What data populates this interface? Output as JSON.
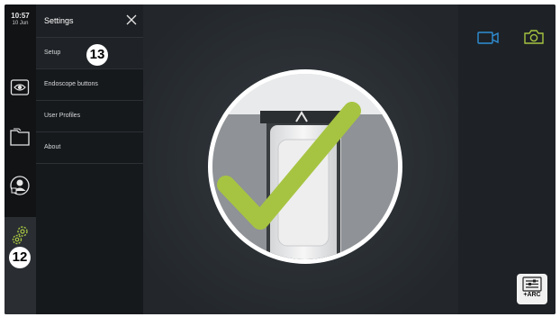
{
  "status": {
    "time": "10:57",
    "date": "10 Jun"
  },
  "rail": {
    "items": [
      {
        "name": "eye-icon"
      },
      {
        "name": "folder-icon"
      },
      {
        "name": "user-profile-icon"
      },
      {
        "name": "settings-gear-icon"
      }
    ]
  },
  "settings": {
    "title": "Settings",
    "items": [
      {
        "label": "Setup"
      },
      {
        "label": "Endoscope buttons"
      },
      {
        "label": "User Profiles"
      },
      {
        "label": "About"
      }
    ]
  },
  "callouts": {
    "settings_gear": "12",
    "setup": "13"
  },
  "toolbar": {
    "arc_label": "+ARC"
  },
  "colors": {
    "accent_green": "#a6c441",
    "accent_blue": "#2f8fd6",
    "panel": "#16191c",
    "rail": "#111315"
  }
}
